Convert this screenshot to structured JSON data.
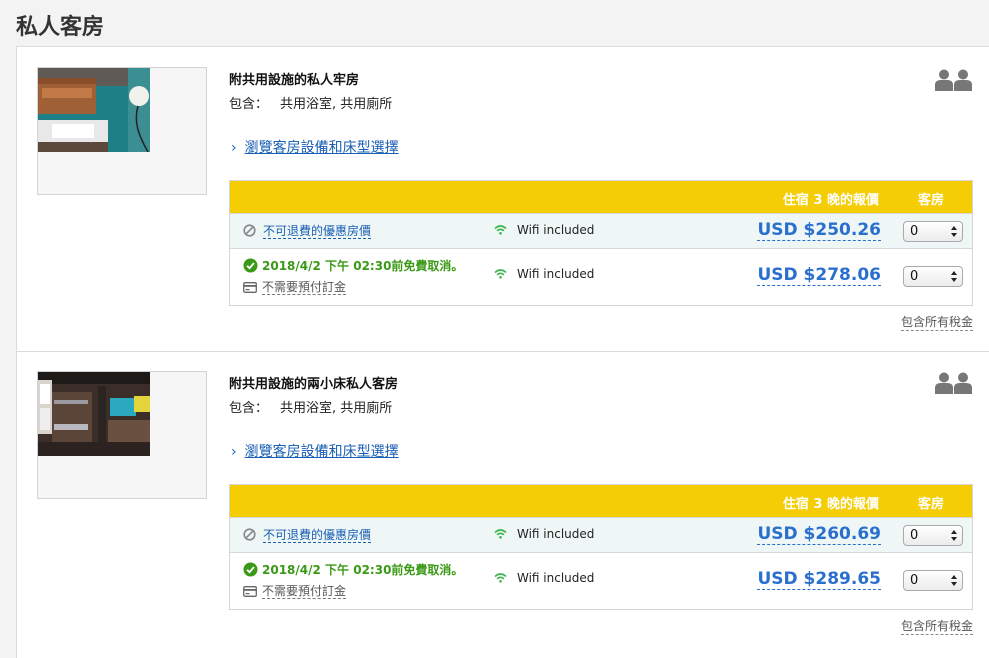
{
  "section_title": "私人客房",
  "rooms": [
    {
      "name": "附共用設施的私人牢房",
      "includes_label": "包含：",
      "includes_value": "共用浴室, 共用廁所",
      "browse_label": "瀏覽客房設備和床型選擇",
      "header_price": "住宿 3 晚的報價",
      "header_rooms": "客房",
      "rates": [
        {
          "policy": "不可退費的優惠房價",
          "wifi": "Wifi included",
          "price": "USD $250.26",
          "qty": "0"
        },
        {
          "cancel": "2018/4/2 下午 02:30前免費取消。",
          "prepay": "不需要預付訂金",
          "wifi": "Wifi included",
          "price": "USD $278.06",
          "qty": "0"
        }
      ],
      "tax_note": "包含所有稅金"
    },
    {
      "name": "附共用設施的兩小床私人客房",
      "includes_label": "包含：",
      "includes_value": "共用浴室, 共用廁所",
      "browse_label": "瀏覽客房設備和床型選擇",
      "header_price": "住宿 3 晚的報價",
      "header_rooms": "客房",
      "rates": [
        {
          "policy": "不可退費的優惠房價",
          "wifi": "Wifi included",
          "price": "USD $260.69",
          "qty": "0"
        },
        {
          "cancel": "2018/4/2 下午 02:30前免費取消。",
          "prepay": "不需要預付訂金",
          "wifi": "Wifi included",
          "price": "USD $289.65",
          "qty": "0"
        }
      ],
      "tax_note": "包含所有稅金"
    }
  ],
  "colors": {
    "header_yellow": "#f5cd05",
    "link_blue": "#1a5fb4",
    "price_blue": "#2a6fcd",
    "cancel_green": "#3a9a16",
    "wifi_green": "#3bb54a"
  }
}
